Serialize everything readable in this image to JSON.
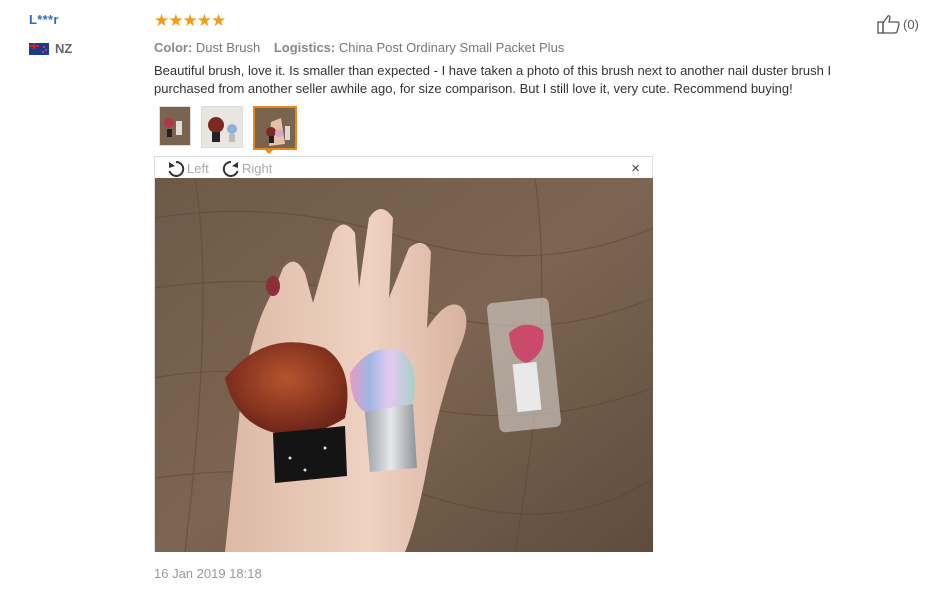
{
  "reviewer": {
    "name": "L***r",
    "country": "NZ",
    "flag_icon": "new-zealand-flag-icon"
  },
  "review": {
    "stars": "★★★★★",
    "rating": 5,
    "color_label": "Color:",
    "color_value": "Dust Brush",
    "logistics_label": "Logistics:",
    "logistics_value": "China Post Ordinary Small Packet Plus",
    "text": "Beautiful brush, love it. Is smaller than expected - I have taken a photo of this brush next to another nail duster brush I purchased from another seller awhile ago, for size comparison. But I still love it, very cute. Recommend buying!",
    "date": "16 Jan 2019 18:18"
  },
  "like": {
    "count": "(0)",
    "icon": "thumbs-up-icon"
  },
  "viewer": {
    "rotate_left_label": "Left",
    "rotate_right_label": "Right",
    "close_glyph": "×"
  },
  "colors": {
    "star": "#f39c12",
    "username": "#2f6bbf",
    "selected_border": "#e5891c"
  }
}
